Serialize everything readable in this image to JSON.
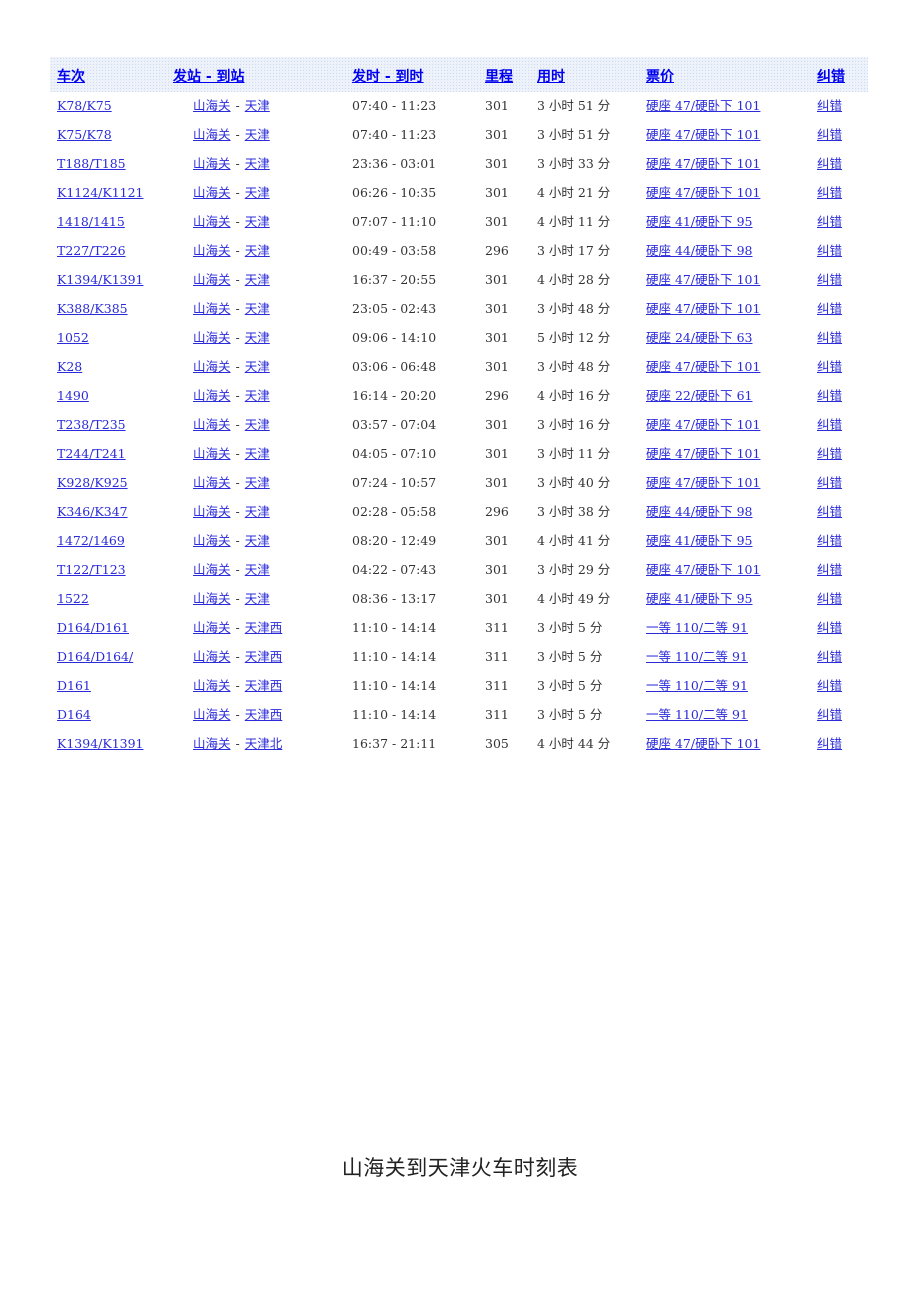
{
  "table": {
    "headers": {
      "train": "车次",
      "route": "发站 - 到站",
      "time": "发时 - 到时",
      "distance": "里程",
      "duration": "用时",
      "price": "票价",
      "report": "纠错"
    },
    "separator": "-",
    "rows": [
      {
        "train": "K78/K75",
        "from": "山海关",
        "to": "天津",
        "time": "07:40 - 11:23",
        "distance": "301",
        "duration": "3 小时 51 分",
        "price": "硬座 47/硬卧下 101",
        "report": "纠错"
      },
      {
        "train": "K75/K78",
        "from": "山海关",
        "to": "天津",
        "time": "07:40 - 11:23",
        "distance": "301",
        "duration": "3 小时 51 分",
        "price": "硬座 47/硬卧下 101",
        "report": "纠错"
      },
      {
        "train": "T188/T185",
        "from": "山海关",
        "to": "天津",
        "time": "23:36 - 03:01",
        "distance": "301",
        "duration": "3 小时 33 分",
        "price": "硬座 47/硬卧下 101",
        "report": "纠错"
      },
      {
        "train": "K1124/K1121",
        "from": "山海关",
        "to": "天津",
        "time": "06:26 - 10:35",
        "distance": "301",
        "duration": "4 小时 21 分",
        "price": "硬座 47/硬卧下 101",
        "report": "纠错"
      },
      {
        "train": "1418/1415",
        "from": "山海关",
        "to": "天津",
        "time": "07:07 - 11:10",
        "distance": "301",
        "duration": "4 小时 11 分",
        "price": "硬座 41/硬卧下 95",
        "report": "纠错"
      },
      {
        "train": "T227/T226",
        "from": "山海关",
        "to": "天津",
        "time": "00:49 - 03:58",
        "distance": "296",
        "duration": "3 小时 17 分",
        "price": "硬座 44/硬卧下 98",
        "report": "纠错"
      },
      {
        "train": "K1394/K1391",
        "from": "山海关",
        "to": "天津",
        "time": "16:37 - 20:55",
        "distance": "301",
        "duration": "4 小时 28 分",
        "price": "硬座 47/硬卧下 101",
        "report": "纠错"
      },
      {
        "train": "K388/K385",
        "from": "山海关",
        "to": "天津",
        "time": "23:05 - 02:43",
        "distance": "301",
        "duration": "3 小时 48 分",
        "price": "硬座 47/硬卧下 101",
        "report": "纠错"
      },
      {
        "train": "1052",
        "from": "山海关",
        "to": "天津",
        "time": "09:06 - 14:10",
        "distance": "301",
        "duration": "5 小时 12 分",
        "price": "硬座 24/硬卧下 63",
        "report": "纠错"
      },
      {
        "train": "K28",
        "from": "山海关",
        "to": "天津",
        "time": "03:06 - 06:48",
        "distance": "301",
        "duration": "3 小时 48 分",
        "price": "硬座 47/硬卧下 101",
        "report": "纠错"
      },
      {
        "train": "1490",
        "from": "山海关",
        "to": "天津",
        "time": "16:14 - 20:20",
        "distance": "296",
        "duration": "4 小时 16 分",
        "price": "硬座 22/硬卧下 61",
        "report": "纠错"
      },
      {
        "train": "T238/T235",
        "from": "山海关",
        "to": "天津",
        "time": "03:57 - 07:04",
        "distance": "301",
        "duration": "3 小时 16 分",
        "price": "硬座 47/硬卧下 101",
        "report": "纠错"
      },
      {
        "train": "T244/T241",
        "from": "山海关",
        "to": "天津",
        "time": "04:05 - 07:10",
        "distance": "301",
        "duration": "3 小时 11 分",
        "price": "硬座 47/硬卧下 101",
        "report": "纠错"
      },
      {
        "train": "K928/K925",
        "from": "山海关",
        "to": "天津",
        "time": "07:24 - 10:57",
        "distance": "301",
        "duration": "3 小时 40 分",
        "price": "硬座 47/硬卧下 101",
        "report": "纠错"
      },
      {
        "train": "K346/K347",
        "from": "山海关",
        "to": "天津",
        "time": "02:28 - 05:58",
        "distance": "296",
        "duration": "3 小时 38 分",
        "price": "硬座 44/硬卧下 98",
        "report": "纠错"
      },
      {
        "train": "1472/1469",
        "from": "山海关",
        "to": "天津",
        "time": "08:20 - 12:49",
        "distance": "301",
        "duration": "4 小时 41 分",
        "price": "硬座 41/硬卧下 95",
        "report": "纠错"
      },
      {
        "train": "T122/T123",
        "from": "山海关",
        "to": "天津",
        "time": "04:22 - 07:43",
        "distance": "301",
        "duration": "3 小时 29 分",
        "price": "硬座 47/硬卧下 101",
        "report": "纠错"
      },
      {
        "train": "1522",
        "from": "山海关",
        "to": "天津",
        "time": "08:36 - 13:17",
        "distance": "301",
        "duration": "4 小时 49 分",
        "price": "硬座 41/硬卧下 95",
        "report": "纠错"
      },
      {
        "train": "D164/D161",
        "from": "山海关",
        "to": "天津西",
        "time": "11:10 - 14:14",
        "distance": "311",
        "duration": "3 小时 5 分",
        "price": "一等 110/二等 91",
        "report": "纠错"
      },
      {
        "train": "D164/D164/",
        "from": "山海关",
        "to": "天津西",
        "time": "11:10 - 14:14",
        "distance": "311",
        "duration": "3 小时 5 分",
        "price": "一等 110/二等 91",
        "report": "纠错"
      },
      {
        "train": "D161",
        "from": "山海关",
        "to": "天津西",
        "time": "11:10 - 14:14",
        "distance": "311",
        "duration": "3 小时 5 分",
        "price": "一等 110/二等 91",
        "report": "纠错"
      },
      {
        "train": "D164",
        "from": "山海关",
        "to": "天津西",
        "time": "11:10 - 14:14",
        "distance": "311",
        "duration": "3 小时 5 分",
        "price": "一等 110/二等 91",
        "report": "纠错"
      },
      {
        "train": "K1394/K1391",
        "from": "山海关",
        "to": "天津北",
        "time": "16:37 - 21:11",
        "distance": "305",
        "duration": "4 小时 44 分",
        "price": "硬座 47/硬卧下 101",
        "report": "纠错"
      }
    ]
  },
  "footer": {
    "title": "山海关到天津火车时刻表"
  },
  "colors": {
    "link": "#2b2bd9",
    "header_link": "#0000ee",
    "header_bg": "#eef3fb",
    "text": "#333333"
  }
}
